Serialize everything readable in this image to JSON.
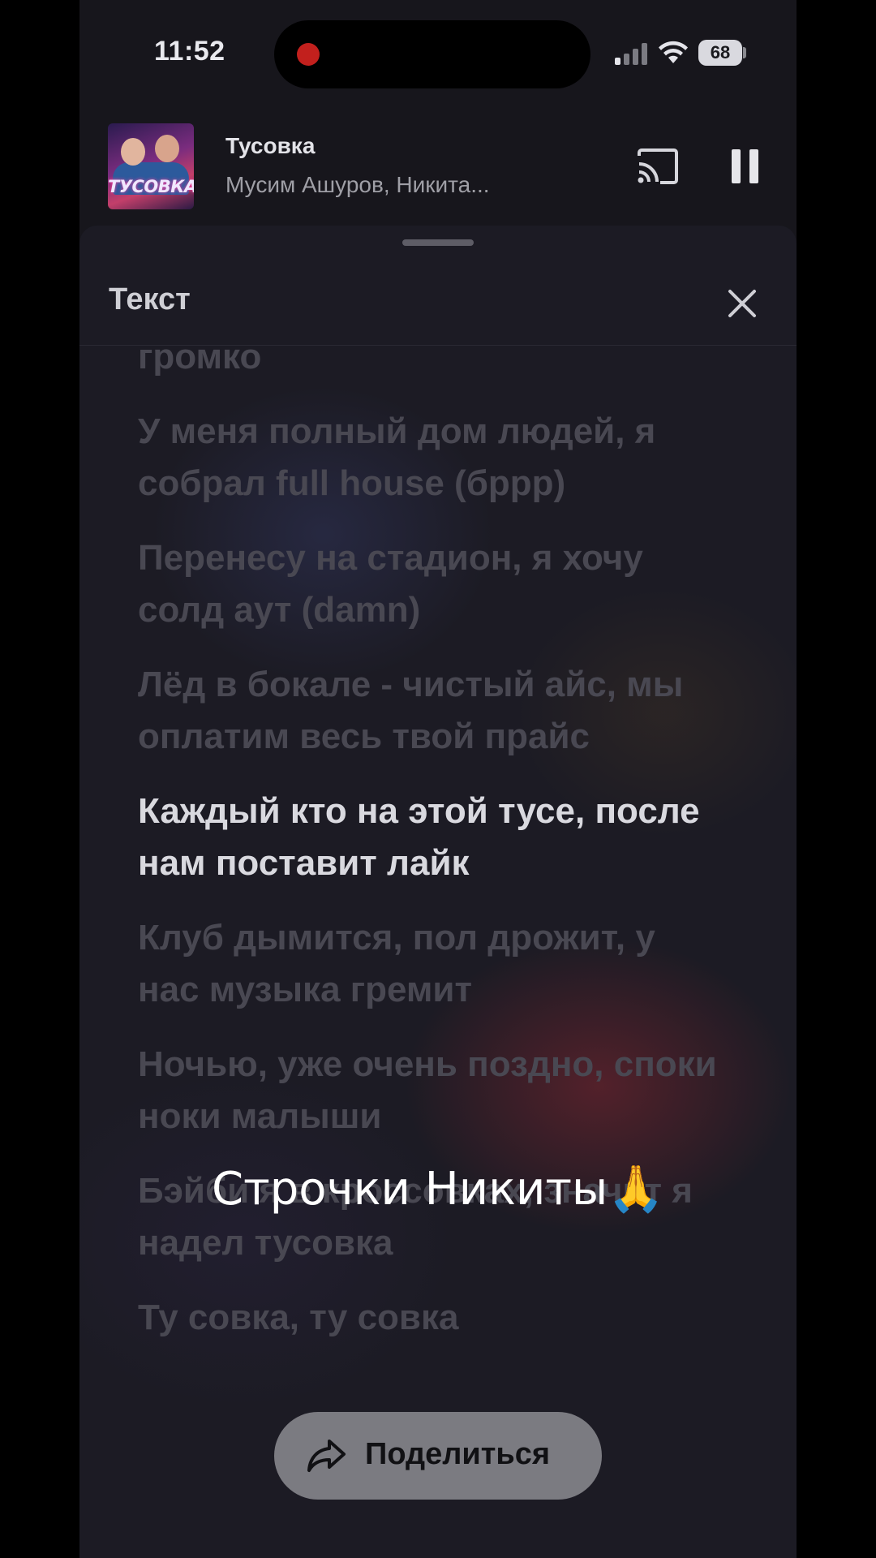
{
  "status_bar": {
    "time": "11:52",
    "battery": "68"
  },
  "mini_player": {
    "album_art_title": "ТУСОВКА",
    "title": "Тусовка",
    "artist": "Мусим Ашуров, Никита..."
  },
  "sheet": {
    "title": "Текст"
  },
  "lyrics": [
    {
      "text": "громко",
      "active": false
    },
    {
      "text": "У меня полный дом людей, я собрал full house (бррр)",
      "active": false
    },
    {
      "text": "Перенесу на стадион, я хочу солд аут (damn)",
      "active": false
    },
    {
      "text": "Лёд в бокале - чистый айс, мы оплатим весь твой прайс",
      "active": false
    },
    {
      "text": "Каждый кто на этой тусе, после нам поставит лайк",
      "active": true
    },
    {
      "text": "Клуб дымится, пол дрожит, у нас музыка гремит",
      "active": false
    },
    {
      "text": "Ночью, уже очень поздно, споки ноки малыши",
      "active": false
    },
    {
      "text": "Бэйби я в кроссовках, значит я надел тусовка",
      "active": false
    },
    {
      "text": "Ту совка, ту совка",
      "active": false
    }
  ],
  "caption": "Строчки Никиты🙏",
  "share_button": {
    "label": "Поделиться"
  },
  "colors": {
    "background": "#17161c",
    "sheet": "#1c1b24",
    "lyric_inactive": "#494852",
    "lyric_active": "#d9d9df",
    "recording_dot": "#c2201d"
  }
}
